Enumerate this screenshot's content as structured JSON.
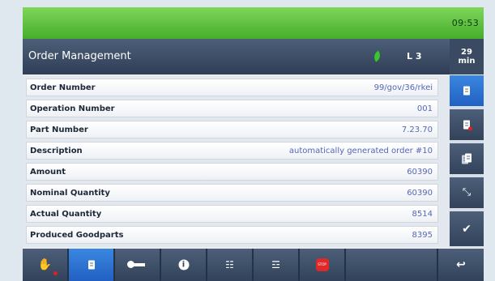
{
  "status": {
    "time": "09:53"
  },
  "header": {
    "title": "Order Management",
    "level": "L 3",
    "duration_value": "29",
    "duration_unit": "min"
  },
  "order_fields": [
    {
      "label": "Order Number",
      "value": "99/gov/36/rkei"
    },
    {
      "label": "Operation Number",
      "value": "001"
    },
    {
      "label": "Part Number",
      "value": "7.23.70"
    },
    {
      "label": "Description",
      "value": "automatically generated order #10"
    },
    {
      "label": "Amount",
      "value": "60390"
    },
    {
      "label": "Nominal Quantity",
      "value": "60390"
    },
    {
      "label": "Actual Quantity",
      "value": "8514"
    },
    {
      "label": "Produced Goodparts",
      "value": "8395"
    }
  ],
  "sidebar": [
    {
      "icon": "document-icon",
      "active": true
    },
    {
      "icon": "document-error-icon",
      "active": false
    },
    {
      "icon": "copy-documents-icon",
      "active": false
    },
    {
      "icon": "expand-arrows-icon",
      "active": false
    },
    {
      "icon": "checkmark-icon",
      "active": false
    }
  ],
  "toolbar": [
    {
      "icon": "operator-hand-icon",
      "active": false
    },
    {
      "icon": "document-icon",
      "active": true
    },
    {
      "icon": "key-icon",
      "active": false
    },
    {
      "icon": "info-icon",
      "active": false
    },
    {
      "icon": "workplan-icon",
      "active": false
    },
    {
      "icon": "settings-sliders-icon",
      "active": false
    },
    {
      "icon": "stop-icon",
      "active": false,
      "label": "STOP"
    },
    {
      "icon": "back-arrow-icon",
      "active": false
    }
  ],
  "colors": {
    "status_green": "#46ad2b",
    "header_dark": "#2f3e55",
    "active_blue": "#2160c2",
    "value_blue": "#5568b6"
  }
}
